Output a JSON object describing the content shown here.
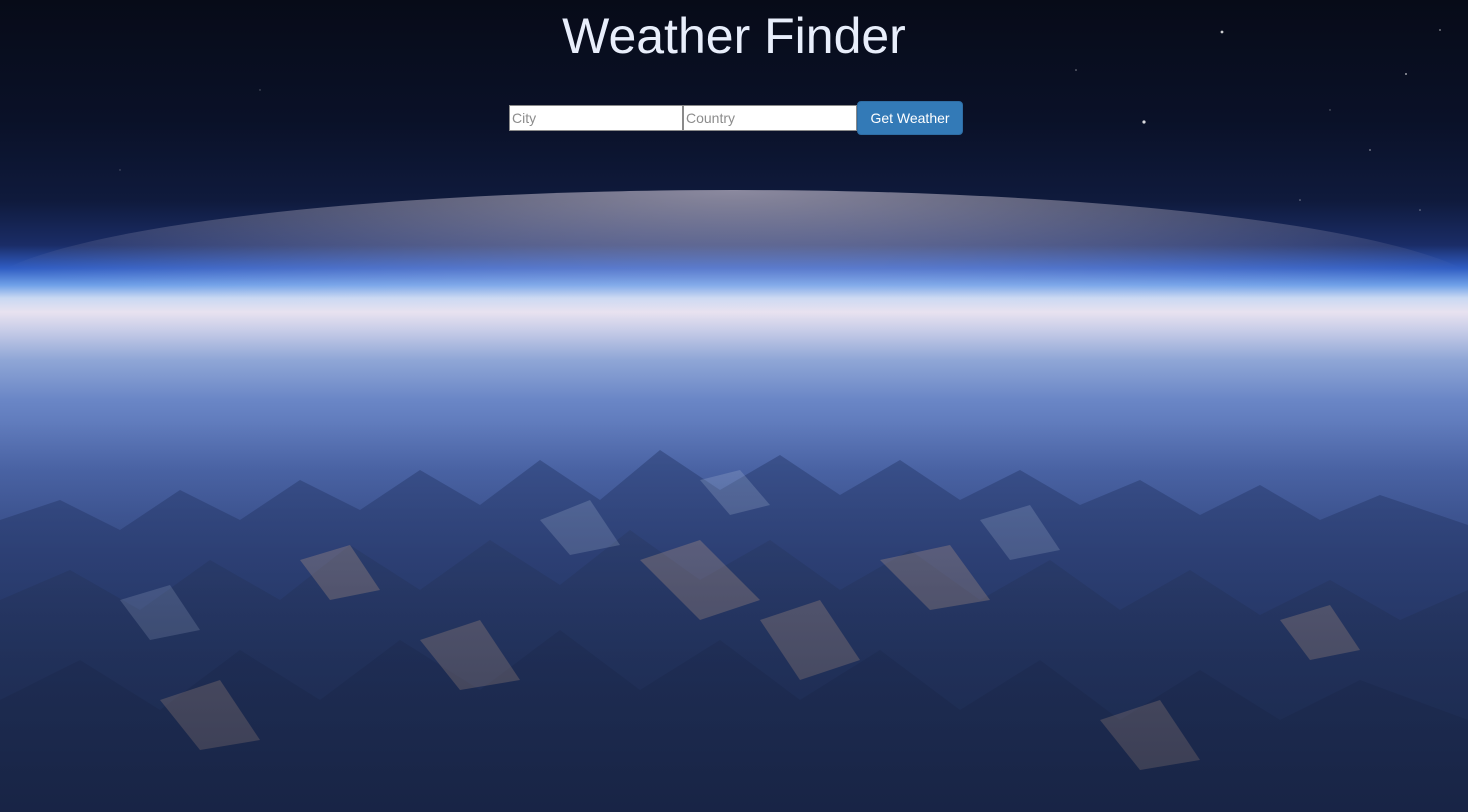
{
  "page": {
    "title": "Weather Finder"
  },
  "form": {
    "city_placeholder": "City",
    "country_placeholder": "Country",
    "submit_label": "Get Weather"
  },
  "colors": {
    "button_bg": "#337ab7",
    "title_color": "#e8eefb"
  }
}
